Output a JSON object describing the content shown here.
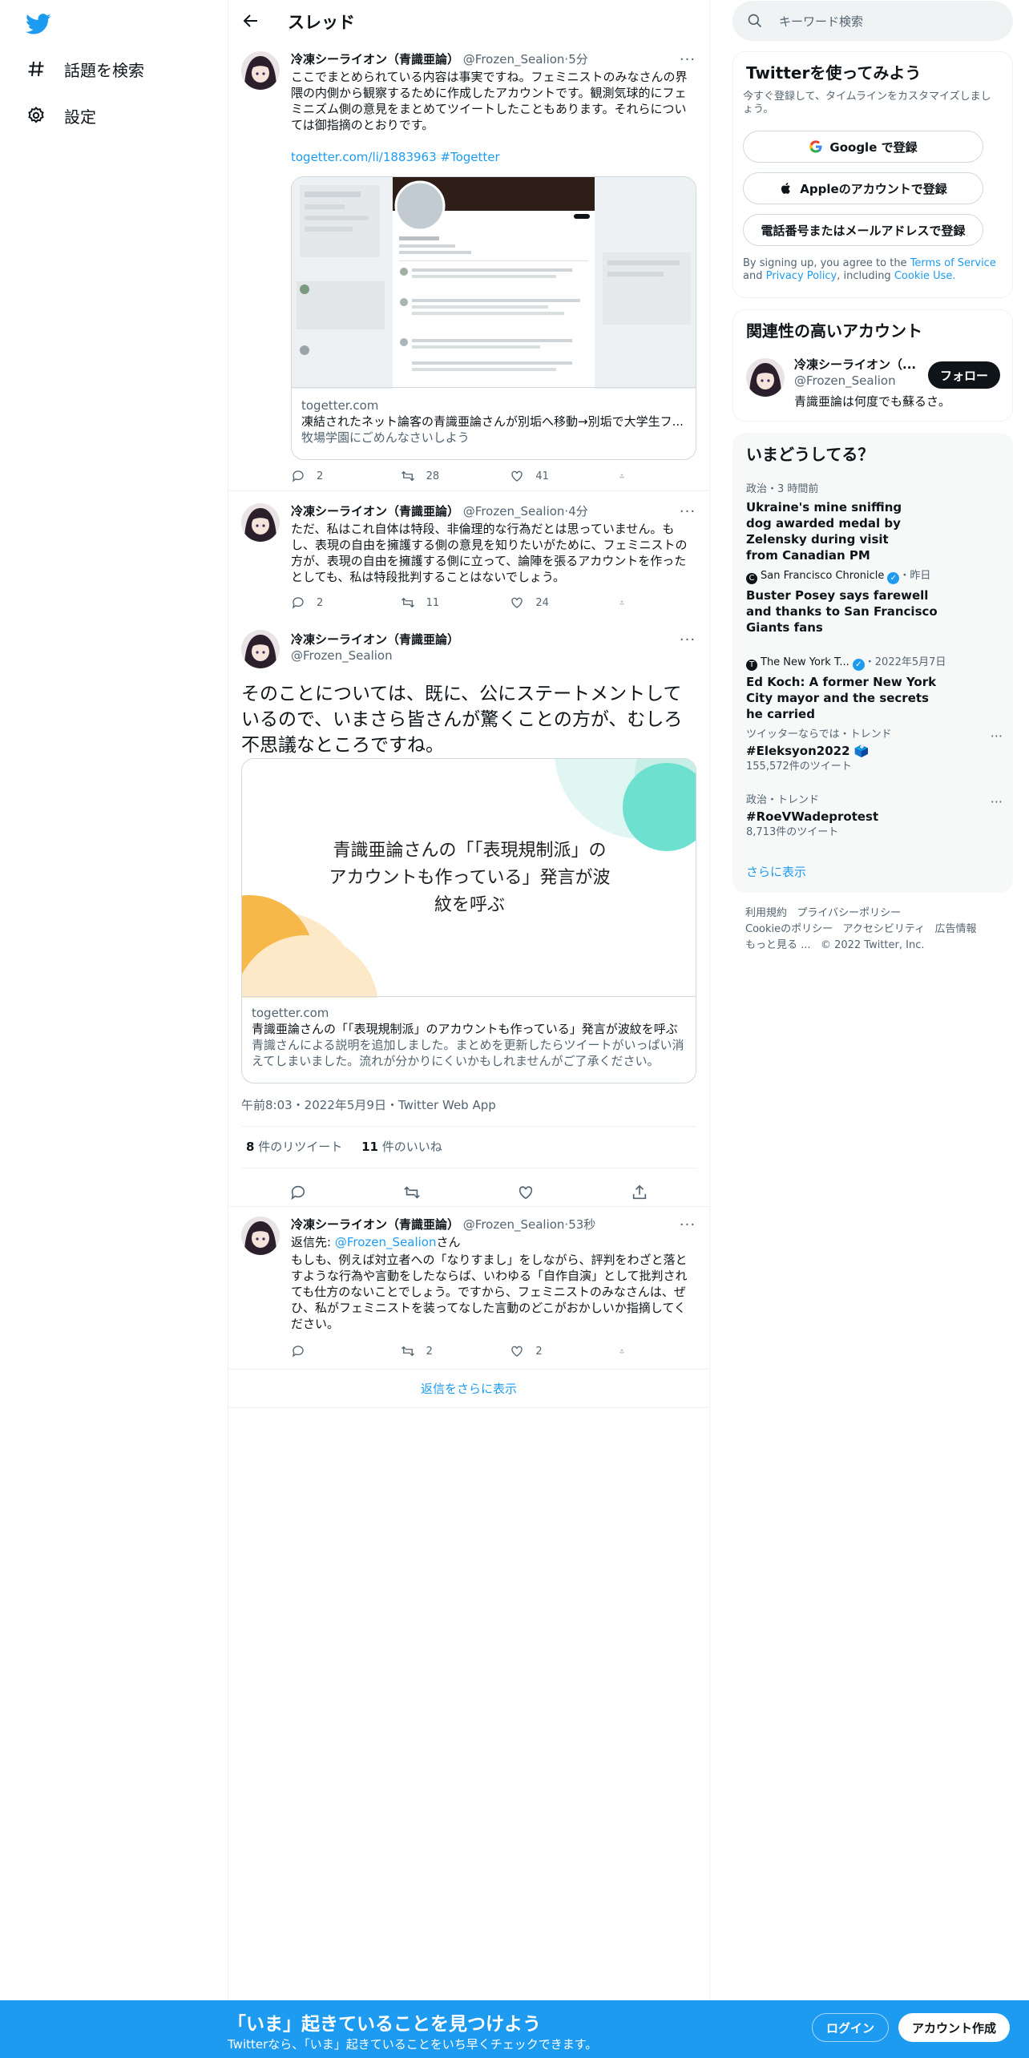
{
  "colors": {
    "brand": "#1d9bf0",
    "text": "#0f1419",
    "secondary": "#536471",
    "border": "#eff3f4",
    "accent_teal": "#6ee0d0",
    "accent_orange": "#f7b84a"
  },
  "nav": {
    "logo_icon": "twitter-bird-icon",
    "items": [
      {
        "icon": "hash-icon",
        "label": "話題を検索"
      },
      {
        "icon": "gear-icon",
        "label": "設定"
      }
    ]
  },
  "header": {
    "back_icon": "arrow-left-icon",
    "title": "スレッド"
  },
  "tweets": [
    {
      "name": "冷凍シーライオン（青識亜論）",
      "handle": "@Frozen_Sealion",
      "time": "5分",
      "text": "ここでまとめられている内容は事実ですね。フェミニストのみなさんの界隈の内側から観察するために作成したアカウントです。観測気球的にフェミニズム側の意見をまとめてツイートしたこともあります。それらについては御指摘のとおりです。",
      "link": "togetter.com/li/1883963",
      "hashtag": "#Togetter",
      "card": {
        "domain": "togetter.com",
        "title": "凍結されたネット論客の青識亜論さんが別垢へ移動→別垢で大学生フ...",
        "desc": "牧場学園にごめんなさいしよう"
      },
      "replies": "2",
      "retweets": "28",
      "likes": "41"
    },
    {
      "name": "冷凍シーライオン（青識亜論）",
      "handle": "@Frozen_Sealion",
      "time": "4分",
      "text": "ただ、私はこれ自体は特段、非倫理的な行為だとは思っていません。もし、表現の自由を擁護する側の意見を知りたいがために、フェミニストの方が、表現の自由を擁護する側に立って、論陣を張るアカウントを作ったとしても、私は特段批判することはないでしょう。",
      "replies": "2",
      "retweets": "11",
      "likes": "24"
    }
  ],
  "main_tweet": {
    "name": "冷凍シーライオン（青識亜論）",
    "handle": "@Frozen_Sealion",
    "text": "そのことについては、既に、公にステートメントしているので、いまさら皆さんが驚くことの方が、むしろ不思議なところですね。",
    "card": {
      "headline": "青識亜論さんの「「表現規制派」のアカウントも作っている」発言が波紋を呼ぶ",
      "domain": "togetter.com",
      "title": "青識亜論さんの「「表現規制派」のアカウントも作っている」発言が波紋を呼ぶ",
      "desc": "青識さんによる説明を追加しました。まとめを更新したらツイートがいっぱい消えてしまいました。流れが分かりにくいかもしれませんがご了承ください。"
    },
    "meta": "午前8:03・2022年5月9日・Twitter Web App",
    "retweet_count": "8",
    "retweet_label": "件のリツイート",
    "like_count": "11",
    "like_label": "件のいいね"
  },
  "reply": {
    "name": "冷凍シーライオン（青識亜論）",
    "handle": "@Frozen_Sealion",
    "time": "53秒",
    "reply_prefix": "返信先:",
    "reply_to": "@Frozen_Sealion",
    "reply_suffix": "さん",
    "text": "もしも、例えば対立者への「なりすまし」をしながら、評判をわざと落とすような行為や言動をしたならば、いわゆる「自作自演」として批判されても仕方のないことでしょう。ですから、フェミニストのみなさんは、ぜひ、私がフェミニストを装ってなした言動のどこがおかしいか指摘してください。",
    "replies": "",
    "retweets": "2",
    "likes": "2"
  },
  "show_more_replies": "返信をさらに表示",
  "search": {
    "placeholder": "キーワード検索"
  },
  "signup_panel": {
    "title": "Twitterを使ってみよう",
    "subtitle": "今すぐ登録して、タイムラインをカスタマイズしましょう。",
    "google": "Google で登録",
    "apple": "Appleのアカウントで登録",
    "phone": "電話番号またはメールアドレスで登録",
    "terms_prefix": "By signing up, you agree to the",
    "terms": "Terms of Service",
    "and": "and",
    "privacy": "Privacy Policy",
    "including": ", including",
    "cookie": "Cookie Use."
  },
  "related": {
    "title": "関連性の高いアカウント",
    "name": "冷凍シーライオン（...",
    "handle": "@Frozen_Sealion",
    "bio": "青識亜論は何度でも蘇るさ。",
    "follow": "フォロー"
  },
  "trends": {
    "title": "いまどうしてる？",
    "items": [
      {
        "context": "政治・3 時間前",
        "title": "Ukraine's mine sniffing dog awarded medal by Zelensky during visit from Canadian PM"
      },
      {
        "source": "San Francisco Chronicle",
        "when": "・昨日",
        "title": "Buster Posey says farewell and thanks to San Francisco Giants fans"
      },
      {
        "source": "The New York T...",
        "when": "・2022年5月7日",
        "title": "Ed Koch: A former New York City mayor and the secrets he carried"
      },
      {
        "context": "ツイッターならでは・トレンド",
        "title": "#Eleksyon2022 🗳️",
        "count": "155,572件のツイート"
      },
      {
        "context": "政治・トレンド",
        "title": "#RoeVWadeprotest",
        "count": "8,713件のツイート"
      }
    ],
    "show_more": "さらに表示"
  },
  "footer": {
    "line1": [
      "利用規約",
      "プライバシーポリシー"
    ],
    "line2": [
      "Cookieのポリシー",
      "アクセシビリティ",
      "広告情報"
    ],
    "more": "もっと見る ...",
    "copyright": "© 2022 Twitter, Inc."
  },
  "bottom_bar": {
    "title": "「いま」起きていることを見つけよう",
    "subtitle": "Twitterなら、「いま」起きていることをいち早くチェックできます。",
    "login": "ログイン",
    "signup": "アカウント作成"
  }
}
